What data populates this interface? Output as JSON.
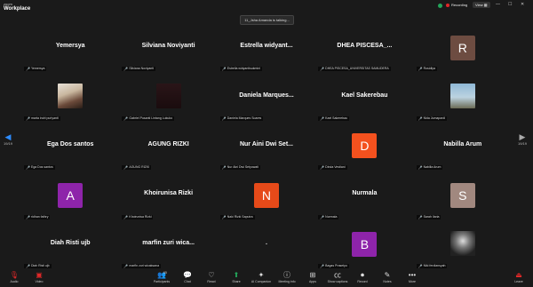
{
  "app": {
    "brand_top": "zoom",
    "brand_name": "Workplace"
  },
  "top": {
    "talking": "11_Jsha Amanda is talking...",
    "recording": "Recording",
    "view": "View"
  },
  "nav": {
    "page_left": "19/19",
    "page_right": "19/19"
  },
  "tiles": [
    {
      "name": "Yemersya",
      "label": "Yemersya"
    },
    {
      "name": "Silviana Noviyanti",
      "label": "Silviana Noviyanti"
    },
    {
      "name": "Estrella widyant...",
      "label": "Estrella widyantisukmini"
    },
    {
      "name": "DHEA  PISCESA_...",
      "label": "DHEA PISCESA_UNIVERSITAS SAMUDERA"
    },
    {
      "avatar": "R",
      "color": "#6d4c41",
      "label": "Rosidlya"
    },
    {
      "photo": "portrait",
      "label": "marta indri puriyanti"
    },
    {
      "photo": "dark",
      "label": "Gabriel Pusanti Lintang Lukuko"
    },
    {
      "name": "Daniela  Marques...",
      "label": "Daniela Marques Soares"
    },
    {
      "name": "Kael Sakerebau",
      "label": "Kael Sakerebau"
    },
    {
      "photo": "sky",
      "label": "Nida Jumapardi"
    },
    {
      "name": "Ega Dos santos",
      "label": "Ega Dos santos"
    },
    {
      "name": "AGUNG RIZKI",
      "label": "AGUNG RIZKI"
    },
    {
      "name": "Nur Aini Dwi Set...",
      "label": "Nur Aini Dwi Setyowati"
    },
    {
      "avatar": "D",
      "color": "#f4511e",
      "label": "Dinda Vestiani"
    },
    {
      "name": "Nabilla Arum",
      "label": "Nabilla Arum"
    },
    {
      "avatar": "A",
      "color": "#8e24aa",
      "label": "ridhan fathry"
    },
    {
      "name": "Khoirunisa Rizki",
      "label": "Khoirunisa Rizki"
    },
    {
      "avatar": "N",
      "color": "#e64a19",
      "label": "Naki Rizki Saputra"
    },
    {
      "name": "Nurmala",
      "label": "Nurmala"
    },
    {
      "avatar": "S",
      "color": "#a1887f",
      "label": "Sarah Ilaria"
    },
    {
      "name": "Diah Risti ujb",
      "label": "Diah Risti ujb"
    },
    {
      "name": "marfin zuri wica...",
      "label": "marfin zuri wicaksana"
    },
    {
      "name": ".",
      "label": ""
    },
    {
      "avatar": "B",
      "color": "#8e24aa",
      "label": "Bagas Prasetyo"
    },
    {
      "photo": "bw",
      "label": "Niki ferdiansyah"
    }
  ],
  "toolbar": {
    "audio": "Audio",
    "video": "Video",
    "participants": "Participants",
    "participants_count": "65",
    "chat": "Chat",
    "react": "React",
    "share": "Share",
    "ai": "AI Companion",
    "meeting_info": "Meeting info",
    "apps": "Apps",
    "captions": "Show captions",
    "record": "Record",
    "notes": "Notes",
    "more": "More",
    "leave": "Leave"
  }
}
